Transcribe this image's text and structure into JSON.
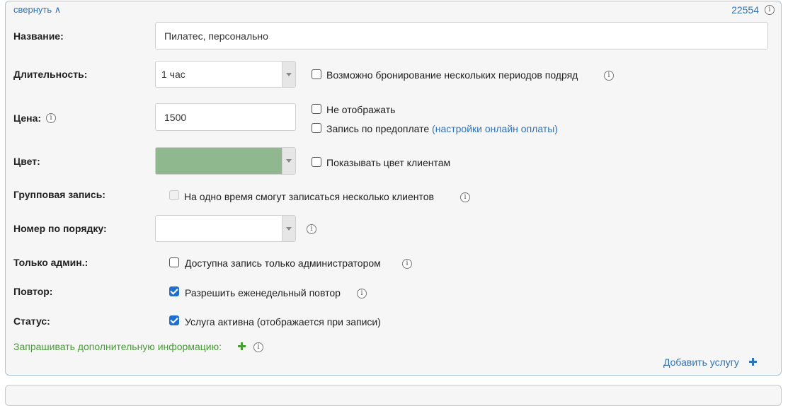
{
  "header": {
    "collapse_link": "свернуть ∧",
    "service_id": "22554"
  },
  "fields": {
    "name": {
      "label": "Название:",
      "value": "Пилатес, персонально"
    },
    "duration": {
      "label": "Длительность:",
      "value": "1 час",
      "multi_period_label": "Возможно бронирование нескольких периодов подряд",
      "multi_period_checked": false
    },
    "price": {
      "label": "Цена:",
      "value": "1500",
      "hide_label": "Не отображать",
      "hide_checked": false,
      "prepay_label": "Запись по предоплате",
      "prepay_link": "(настройки онлайн оплаты)",
      "prepay_checked": false
    },
    "color": {
      "label": "Цвет:",
      "value_color": "#8fb88f",
      "show_label": "Показывать цвет клиентам",
      "show_checked": false
    },
    "group": {
      "label": "Групповая запись:",
      "option_label": "На одно время смогут записаться несколько клиентов",
      "checked": false,
      "disabled": true
    },
    "order": {
      "label": "Номер по порядку:",
      "value": ""
    },
    "admin_only": {
      "label": "Только админ.:",
      "option_label": "Доступна запись только администратором",
      "checked": false
    },
    "repeat": {
      "label": "Повтор:",
      "option_label": "Разрешить еженедельный повтор",
      "checked": true
    },
    "status": {
      "label": "Статус:",
      "option_label": "Услуга активна (отображается при записи)",
      "checked": true
    }
  },
  "extra_info": {
    "label": "Запрашивать дополнительную информацию:"
  },
  "add_service": {
    "label": "Добавить услугу"
  },
  "colors": {
    "link": "#2f72b5",
    "accent_green": "#4a9a3a",
    "checkbox_checked": "#1f6fd1"
  },
  "icons": [
    "info-icon",
    "plus-icon",
    "chevron-down-icon",
    "checkmark-icon"
  ]
}
